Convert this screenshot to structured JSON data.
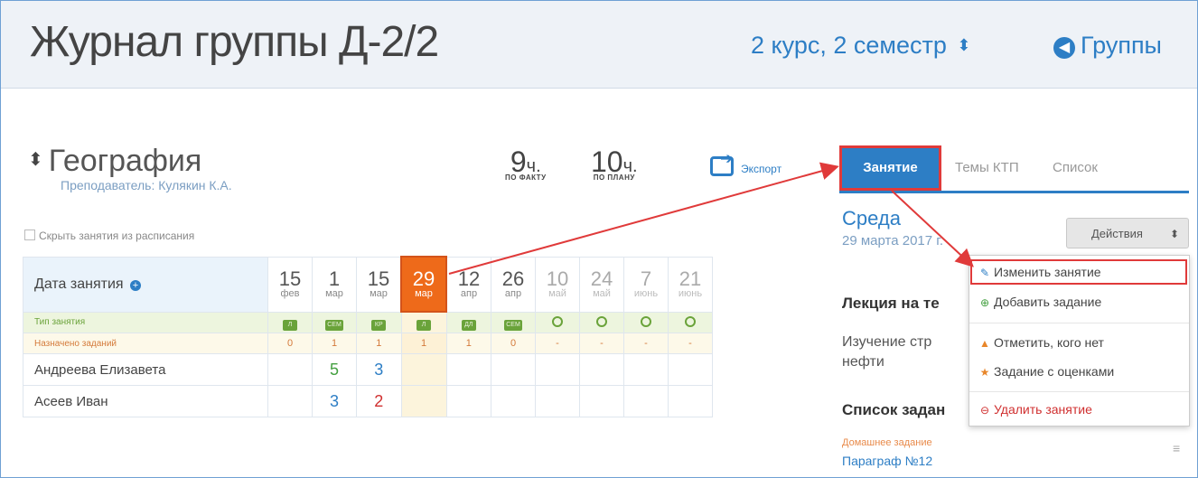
{
  "header": {
    "title": "Журнал группы Д-2/2",
    "semester": "2 курс, 2 семестр",
    "semester_icon": "sort-icon",
    "groups": "Группы",
    "groups_icon": "circle-arrow-left-icon"
  },
  "subject": {
    "name": "География",
    "teacher": "Преподаватель: Кулякин К.А.",
    "hide_label": "Скрыть занятия из расписания",
    "hours_fact_value": "9",
    "hours_fact_unit": "ч.",
    "hours_fact_caption": "ПО ФАКТУ",
    "hours_plan_value": "10",
    "hours_plan_unit": "ч.",
    "hours_plan_caption": "ПО ПЛАНУ",
    "export_label": "Экспорт"
  },
  "grid": {
    "date_header": "Дата занятия",
    "dates": [
      {
        "day": "15",
        "month": "фев"
      },
      {
        "day": "1",
        "month": "мар"
      },
      {
        "day": "15",
        "month": "мар"
      },
      {
        "day": "29",
        "month": "мар"
      },
      {
        "day": "12",
        "month": "апр"
      },
      {
        "day": "26",
        "month": "апр"
      },
      {
        "day": "10",
        "month": "май"
      },
      {
        "day": "24",
        "month": "май"
      },
      {
        "day": "7",
        "month": "июнь"
      },
      {
        "day": "21",
        "month": "июнь"
      }
    ],
    "type_label": "Тип занятия",
    "types": [
      "Л",
      "СЕМ",
      "КР",
      "Л",
      "ДЛ",
      "СЕМ",
      "",
      "",
      "",
      ""
    ],
    "assigned_label": "Назначено заданий",
    "assigned": [
      "0",
      "1",
      "1",
      "1",
      "1",
      "0",
      "-",
      "-",
      "-",
      "-"
    ],
    "students": [
      {
        "name": "Андреева Елизавета",
        "grades": [
          "",
          "5",
          "3",
          "",
          "",
          "",
          "",
          "",
          "",
          ""
        ]
      },
      {
        "name": "Асеев Иван",
        "grades": [
          "",
          "3",
          "2",
          "",
          "",
          "",
          "",
          "",
          "",
          ""
        ]
      }
    ]
  },
  "panel": {
    "tabs": [
      "Занятие",
      "Темы КТП",
      "Список"
    ],
    "day": "Среда",
    "date": "29 марта 2017 г.",
    "actions_label": "Действия",
    "lecture": "Лекция на те",
    "description": "Изучение стр нефти",
    "tasks_header": "Список задан",
    "homework_label": "Домашнее задание",
    "homework_value": "Параграф №12"
  },
  "menu": {
    "items": [
      {
        "label": "Изменить занятие",
        "icon": "pencil-icon"
      },
      {
        "label": "Добавить задание",
        "icon": "plus-circle-icon"
      },
      {
        "label": "Отметить, кого нет",
        "icon": "bell-icon"
      },
      {
        "label": "Задание с оценками",
        "icon": "star-icon"
      },
      {
        "label": "Удалить занятие",
        "icon": "minus-circle-icon"
      }
    ]
  },
  "colors": {
    "accent": "#2d7ec5",
    "active_date": "#ee6a1a",
    "highlight": "#e03a3a",
    "lesson_type": "#6aa33a"
  }
}
